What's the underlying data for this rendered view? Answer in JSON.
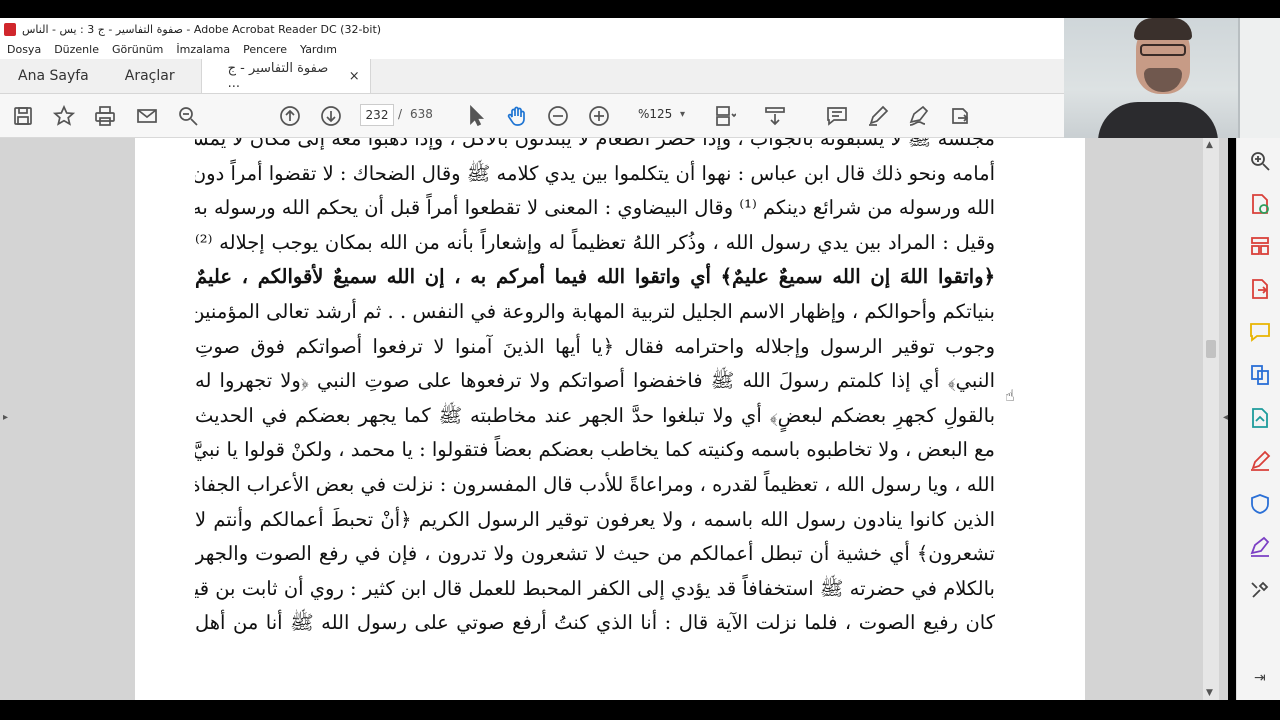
{
  "window": {
    "title": "صفوة التفاسير - ج 3 : يس - الناس - Adobe Acrobat Reader DC (32-bit)"
  },
  "menu": [
    "Dosya",
    "Düzenle",
    "Görünüm",
    "İmzalama",
    "Pencere",
    "Yardım"
  ],
  "tabs": {
    "home": "Ana Sayfa",
    "tools": "Araçlar",
    "document": "صفوة التفاسير - ج ...",
    "close": "×"
  },
  "toolbar": {
    "page_current": "232",
    "page_separator": "/",
    "page_total": "638",
    "zoom": "%125",
    "zoom_caret": "▾"
  },
  "document": {
    "lines": [
      "مجلسه ﷺ لا يسبقونه بالجواب ، وإذا حضر الطعام لا يبتدئون بالأكل ، وإذا ذهبوا معه إلى مكان لا يمشون",
      "أمامه ونحو ذلك قال ابن عباس : نهوا أن يتكلموا بين يدي كلامه ﷺ وقال الضحاك : لا تقضوا أمراً دون",
      "الله ورسوله من شرائع دينكم ⁽¹⁾ وقال البيضاوي : المعنى لا تقطعوا أمراً قبل أن يحكم الله ورسوله به ،",
      "وقيل : المراد بين يدي رسول الله ، وذُكر اللهُ تعظيماً له وإشعاراً بأنه من الله بمكان يوجب إجلاله ⁽²⁾",
      "﴿واتقوا اللهَ إن الله سميعٌ عليمٌ﴾ أي واتقوا الله فيما أمركم به ، إن الله سميعٌ لأقوالكم ، عليمٌ",
      "بنياتكم وأحوالكم ، وإظهار الاسم الجليل لتربية المهابة والروعة في النفس . . ثم أرشد تعالى المؤمنين إلى",
      "وجوب توقير الرسول وإجلاله واحترامه فقال ﴿يا أيها الذينَ آمنوا لا ترفعوا أصواتكم فوق صوتِ",
      "النبي﴾ أي إذا كلمتم رسولَ الله ﷺ فاخفضوا أصواتكم ولا ترفعوها على صوتِ النبي ﴿ولا تجهروا له",
      "بالقولِ كجهرِ بعضكم لبعضٍ﴾ أي ولا تبلغوا حدَّ الجهر عند مخاطبته ﷺ كما يجهر بعضكم في الحديث",
      "مع البعض ، ولا تخاطبوه باسمه وكنيته كما يخاطب بعضكم بعضاً فتقولوا : يا محمد ، ولكنْ قولوا يا نبيَّ",
      "الله ، ويا رسول الله ، تعظيماً لقدره ، ومراعاةً للأدب قال المفسرون : نزلت في بعض الأعراب الجفاة",
      "الذين كانوا ينادون رسول الله باسمه ، ولا يعرفون توقير الرسول الكريم ﴿أنْ تحبطَ أعمالكم وأنتم لا",
      "تشعرون﴾ أي خشية أن تبطل أعمالكم من حيث لا تشعرون ولا تدرون ، فإن في رفع الصوت والجهر",
      "بالكلام في حضرته ﷺ استخفافاً قد يؤدي إلى الكفر المحبط للعمل قال ابن كثير : روي أن ثابت بن قيس",
      "كان رفيع الصوت ، فلما نزلت الآية قال : أنا الذي كنتُ أرفع صوتي على رسول الله ﷺ أنا من أهل"
    ]
  }
}
